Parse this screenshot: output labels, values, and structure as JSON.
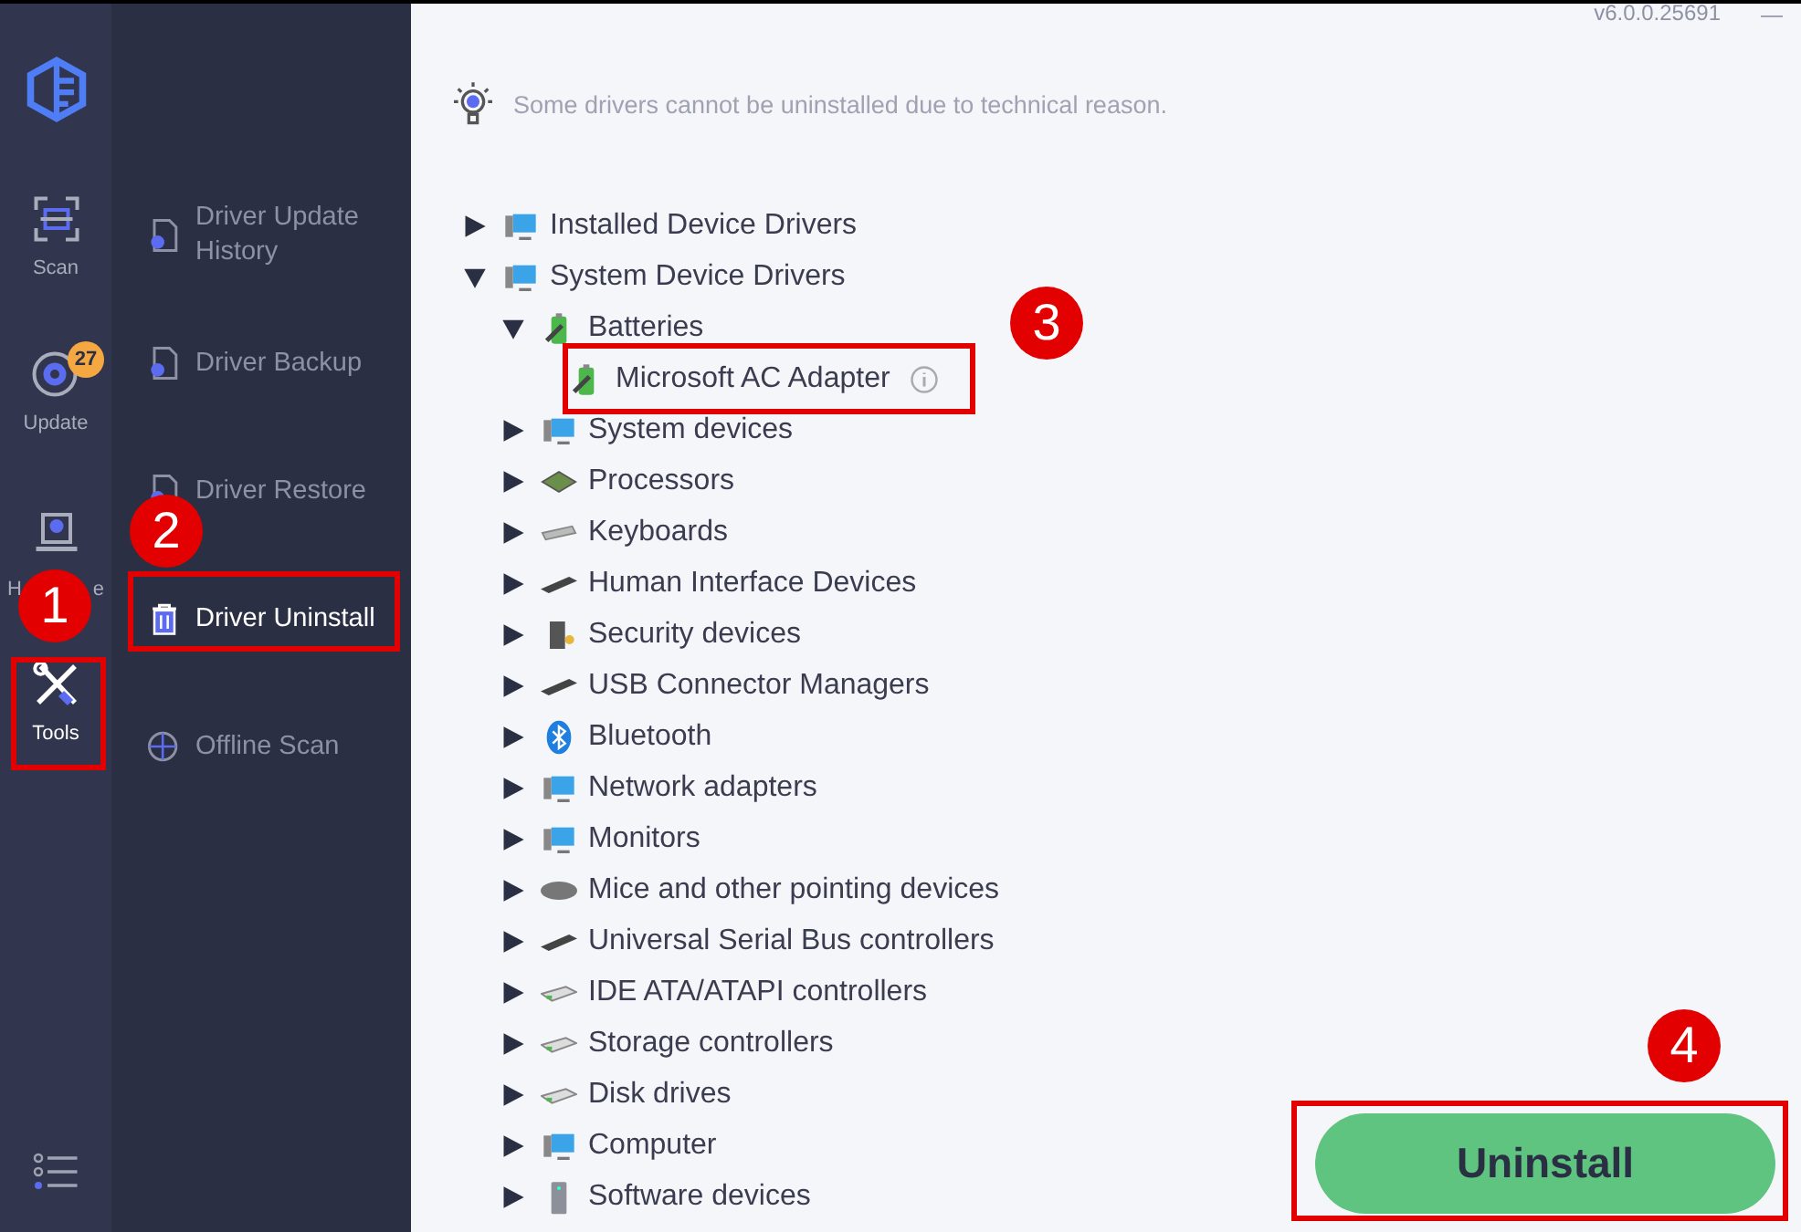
{
  "rail": {
    "items": [
      {
        "label": "Scan",
        "selected": false
      },
      {
        "label": "Update",
        "selected": false,
        "badge": "27"
      },
      {
        "label_parts": [
          "H",
          "e"
        ],
        "selected": false
      },
      {
        "label": "Tools",
        "selected": true
      }
    ]
  },
  "tools_menu": {
    "items": [
      {
        "label": "Driver Update History",
        "selected": false
      },
      {
        "label": "Driver Backup",
        "selected": false
      },
      {
        "label": "Driver Restore",
        "selected": false
      },
      {
        "label": "Driver Uninstall",
        "selected": true
      },
      {
        "label": "Offline Scan",
        "selected": false
      }
    ]
  },
  "version": "v6.0.0.25691",
  "window_controls": [
    "—"
  ],
  "notice": "Some drivers cannot be uninstalled due to technical reason.",
  "tree": [
    {
      "label": "Installed Device Drivers",
      "expanded": false
    },
    {
      "label": "System Device Drivers",
      "expanded": true,
      "children": [
        {
          "label": "Batteries",
          "expanded": true,
          "children": [
            {
              "label": "Microsoft AC Adapter",
              "info": true
            }
          ]
        },
        {
          "label": "System devices",
          "expanded": false
        },
        {
          "label": "Processors",
          "expanded": false
        },
        {
          "label": "Keyboards",
          "expanded": false
        },
        {
          "label": "Human Interface Devices",
          "expanded": false
        },
        {
          "label": "Security devices",
          "expanded": false
        },
        {
          "label": "USB Connector Managers",
          "expanded": false
        },
        {
          "label": "Bluetooth",
          "expanded": false
        },
        {
          "label": "Network adapters",
          "expanded": false
        },
        {
          "label": "Monitors",
          "expanded": false
        },
        {
          "label": "Mice and other pointing devices",
          "expanded": false
        },
        {
          "label": "Universal Serial Bus controllers",
          "expanded": false
        },
        {
          "label": "IDE ATA/ATAPI controllers",
          "expanded": false
        },
        {
          "label": "Storage controllers",
          "expanded": false
        },
        {
          "label": "Disk drives",
          "expanded": false
        },
        {
          "label": "Computer",
          "expanded": false
        },
        {
          "label": "Software devices",
          "expanded": false
        }
      ]
    }
  ],
  "uninstall_button": "Uninstall",
  "callouts": [
    {
      "label": "1"
    },
    {
      "label": "2"
    },
    {
      "label": "3"
    },
    {
      "label": "4"
    }
  ]
}
